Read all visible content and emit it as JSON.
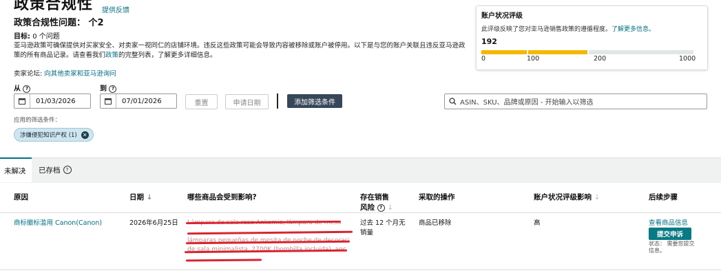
{
  "header": {
    "title": "政策合规性",
    "feedback_link": "提供反馈",
    "issues_label": "政策合规性问题：",
    "issues_count": "个2",
    "goal_label": "目标:",
    "goal_value": "0 个问题",
    "description_part1": "亚马逊政策可确保提供对买家安全、对卖家一视同仁的店铺环境。违反这些政策可能会导致内容被移除或账户被停用。以下是与您的账户关联且违反亚马逊政",
    "description_part2": "策的所有商品记录。请查看我们",
    "description_link": "政策",
    "description_part3": "的完整列表，了解更多详细信息。",
    "forum_label": "卖家论坛:",
    "forum_link": "向其他卖家和亚马逊询问"
  },
  "account_health": {
    "title": "账户状况评级",
    "description": "此评级反映了您对亚马逊销售政策的遵循程度。",
    "learn_more": "了解更多信息。",
    "score": "192",
    "score_value": 192,
    "ticks": [
      "0",
      "100",
      "200",
      "1000"
    ],
    "colors": {
      "good": "#f5b800",
      "empty": "#e3e6e6"
    }
  },
  "filters": {
    "from_label": "从",
    "to_label": "到",
    "from_date": "01/03/2026",
    "to_date": "07/01/2026",
    "reset_label": "重置",
    "apply_date_label": "申请日期",
    "add_filter_label": "添加筛选条件",
    "search_placeholder": "ASIN、SKU、品牌或原因 - 开始输入以筛选",
    "applied_label": "应用的筛选条件：",
    "chip_label": "涉嫌侵犯知识产权 (1)"
  },
  "tabs": [
    {
      "label": "未解决",
      "active": true
    },
    {
      "label": "已存档",
      "active": false
    }
  ],
  "table": {
    "headers": {
      "reason": "原因",
      "date": "日期",
      "affected": "哪些商品会受到影响?",
      "risk_line1": "存在销售",
      "risk_line2": "风险",
      "action": "采取的操作",
      "impact": "账户状况评级影响",
      "next": "后续步骤"
    },
    "row": {
      "reason": "商标徽标滥用 Canon(Canon)",
      "date": "2026年6月25日",
      "risk_line1": "过去 12 个月无",
      "risk_line2": "销量",
      "action": "商品已移除",
      "impact": "高",
      "view_listing": "查看商品信息",
      "appeal_button": "提交申诉",
      "status_line1": "状态：",
      "status_value": "需要您提交",
      "status_line2": "信息。",
      "redacted_line1": "Lámpara de sala rosa Ankomia, lámpara de mesa",
      "redacted_line2": "lámparas pequeñas de mesita de noche de decoración",
      "redacted_line3": "de sala minimalista, 2700K (bombilla incluida), anchura"
    }
  }
}
